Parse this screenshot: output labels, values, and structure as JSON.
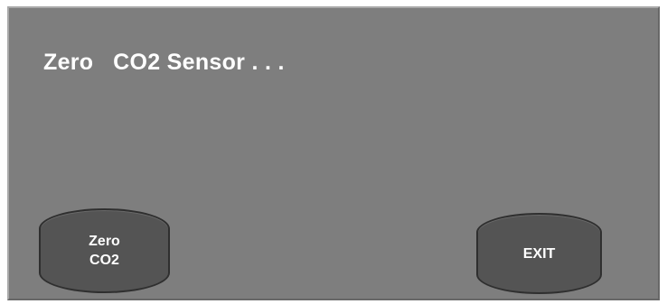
{
  "screen": {
    "title": "Zero   CO2 Sensor . . ."
  },
  "buttons": {
    "zero_line1": "Zero",
    "zero_line2": "CO2",
    "exit_label": "EXIT"
  },
  "colors": {
    "screen_background": "#7e7e7e",
    "button_fill": "#545454",
    "text": "#ffffff"
  }
}
